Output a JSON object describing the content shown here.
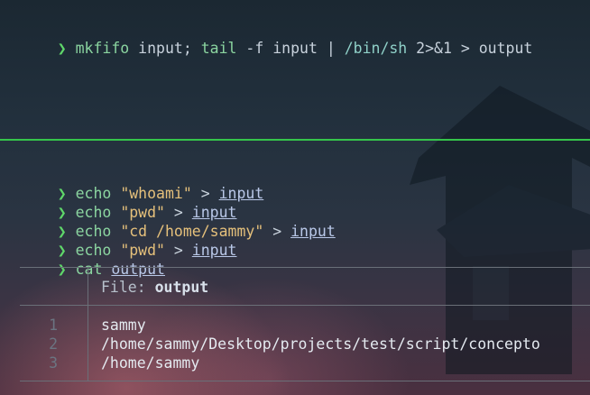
{
  "top": {
    "prompt": "❯",
    "command": {
      "cmd1": "mkfifo",
      "arg1": " input; ",
      "cmd2": "tail",
      "flag": " -f ",
      "arg2": "input | ",
      "path": "/bin/sh",
      "redir": " 2>&1 > output"
    }
  },
  "bottom": {
    "lines": [
      {
        "prompt": "❯",
        "cmd": "echo",
        "str": "\"whoami\"",
        "op": " > ",
        "target": "input"
      },
      {
        "prompt": "❯",
        "cmd": "echo",
        "str": "\"pwd\"",
        "op": " > ",
        "target": "input"
      },
      {
        "prompt": "❯",
        "cmd": "echo",
        "str": "\"cd /home/sammy\"",
        "op": " > ",
        "target": "input"
      },
      {
        "prompt": "❯",
        "cmd": "echo",
        "str": "\"pwd\"",
        "op": " > ",
        "target": "input"
      },
      {
        "prompt": "❯",
        "cmd": "cat",
        "target": "output"
      }
    ],
    "bat": {
      "file_label": "File: ",
      "file_name": "output",
      "line_numbers": [
        "1",
        "2",
        "3"
      ],
      "rows": [
        "sammy",
        "/home/sammy/Desktop/projects/test/script/concepto",
        "/home/sammy"
      ]
    }
  },
  "colors": {
    "prompt": "#5fd76a",
    "divider": "#35c44b",
    "string": "#e5c07b"
  }
}
